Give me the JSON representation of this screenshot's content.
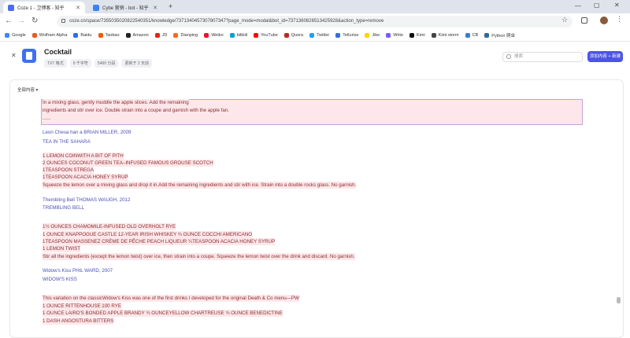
{
  "browser": {
    "tabs": [
      {
        "label": "Coze 1 - 卫博客 - 知乎",
        "color": "#4a6cf7"
      },
      {
        "label": "Cybe 营销 - bot - 知乎",
        "color": "#3b82f6"
      }
    ],
    "new_tab": "+",
    "url": "coze.cn/space/7355035020822540351/knowledge/7371340457307807347?page_mode=modal&bot_id=7371360826513425928&action_type=remove",
    "bookmarks": [
      {
        "label": "Google",
        "color": "#4285f4"
      },
      {
        "label": "Wolfram Alpha",
        "color": "#e85d1c"
      },
      {
        "label": "Baidu",
        "color": "#2b6cf0"
      },
      {
        "label": "Taobao",
        "color": "#f35a0a"
      },
      {
        "label": "Amazon",
        "color": "#222222"
      },
      {
        "label": "JD",
        "color": "#e1251b"
      },
      {
        "label": "Dianping",
        "color": "#f86a1c"
      },
      {
        "label": "Weibo",
        "color": "#e6162d"
      },
      {
        "label": "bilibili",
        "color": "#00a1d6"
      },
      {
        "label": "YouTube",
        "color": "#ff0000"
      },
      {
        "label": "Quora",
        "color": "#b92b27"
      },
      {
        "label": "Twitter",
        "color": "#1da1f2"
      },
      {
        "label": "Tellurise",
        "color": "#2f6fde"
      },
      {
        "label": "Jike",
        "color": "#ffd400"
      },
      {
        "label": "Write",
        "color": "#7c5cff"
      },
      {
        "label": "Kimi",
        "color": "#111111"
      },
      {
        "label": "Kimi storm",
        "color": "#444444"
      },
      {
        "label": "CB",
        "color": "#3a7bd5"
      },
      {
        "label": "Python 爬虫",
        "color": "#306998"
      }
    ]
  },
  "header": {
    "title": "Cocktail",
    "tags": [
      "TXT 格式",
      "9 千字符",
      "5460 分段",
      "更新于 2 天前"
    ],
    "search_placeholder": "搜索",
    "add_button": "添加内容 + 新建"
  },
  "panel": {
    "dropdown": "全部内容"
  },
  "content_lines": [
    {
      "text": "In a mixing glass, gently muddle the apple slices. Add the remaining",
      "cls": ""
    },
    {
      "text": "ingredients and stir over ice. Double strain into a coupe and garnish with the apple fan.",
      "cls": ""
    },
    {
      "text": "......",
      "cls": ""
    },
    {
      "text": "Leon Chesa han a BRIAN MILLER, 2009",
      "cls": "blue"
    },
    {
      "text": "TEA IN THE SAHARA",
      "cls": "blue"
    },
    {
      "text": "1 LEMON COINWITH A BIT OF PITH",
      "cls": ""
    },
    {
      "text": "2 OUNCES COCONUT GREEN TEA–INFUSED FAMOUS GROUSE SCOTCH",
      "cls": ""
    },
    {
      "text": "1TEASPOON STREGA",
      "cls": ""
    },
    {
      "text": "1TEASPOON ACACIA HONEY SYRUP",
      "cls": ""
    },
    {
      "text": "Squeeze the lemon over a mixing glass and drop it in.Add the remaining ingredients and stir with ice. Strain into a double rocks glass. No garnish.",
      "cls": ""
    },
    {
      "text": "Thembling Bell THOMAS WAUGH, 2012",
      "cls": "blue"
    },
    {
      "text": "TREMBLING BELL",
      "cls": "blue"
    },
    {
      "text": "1½ OUNCES CHAMOMILE-INFUSED OLD OVERHOLT RYE",
      "cls": ""
    },
    {
      "text": "1 OUNCE KNAPPOGUE CASTLE 12-YEAR IRISH WHISKEY ¾ OUNCE COCCHI AMERICANO",
      "cls": ""
    },
    {
      "text": "1TEASPOON MASSENEZ CRÈME DE PÊCHE PEACH LIQUEUR ¼TEASPOON ACACIA HONEY SYRUP",
      "cls": ""
    },
    {
      "text": "1 LEMON TWIST",
      "cls": ""
    },
    {
      "text": "Stir all the ingredients (except the lemon twist) over ice, then strain into a coupe. Squeeze the lemon twist over the drink and discard. No garnish.",
      "cls": ""
    },
    {
      "text": "Widow's Kiss PHIL WARD, 2007",
      "cls": "blue"
    },
    {
      "text": "WIDOW'S KISS",
      "cls": "blue"
    },
    {
      "text": "This variation on the classicWidow's Kiss was one of the first drinks I developed for the original Death & Co menu—PW",
      "cls": ""
    },
    {
      "text": "1 OUNCE RITTENHOUSE 100 RYE",
      "cls": ""
    },
    {
      "text": "1 OUNCE LAIRD'S BONDED APPLE BRANDY ¾ OUNCEYELLOW CHARTREUSE ¾ OUNCE BENEDICTINE",
      "cls": ""
    },
    {
      "text": "1 DASH ANGOSTURA BITTERS",
      "cls": ""
    }
  ]
}
